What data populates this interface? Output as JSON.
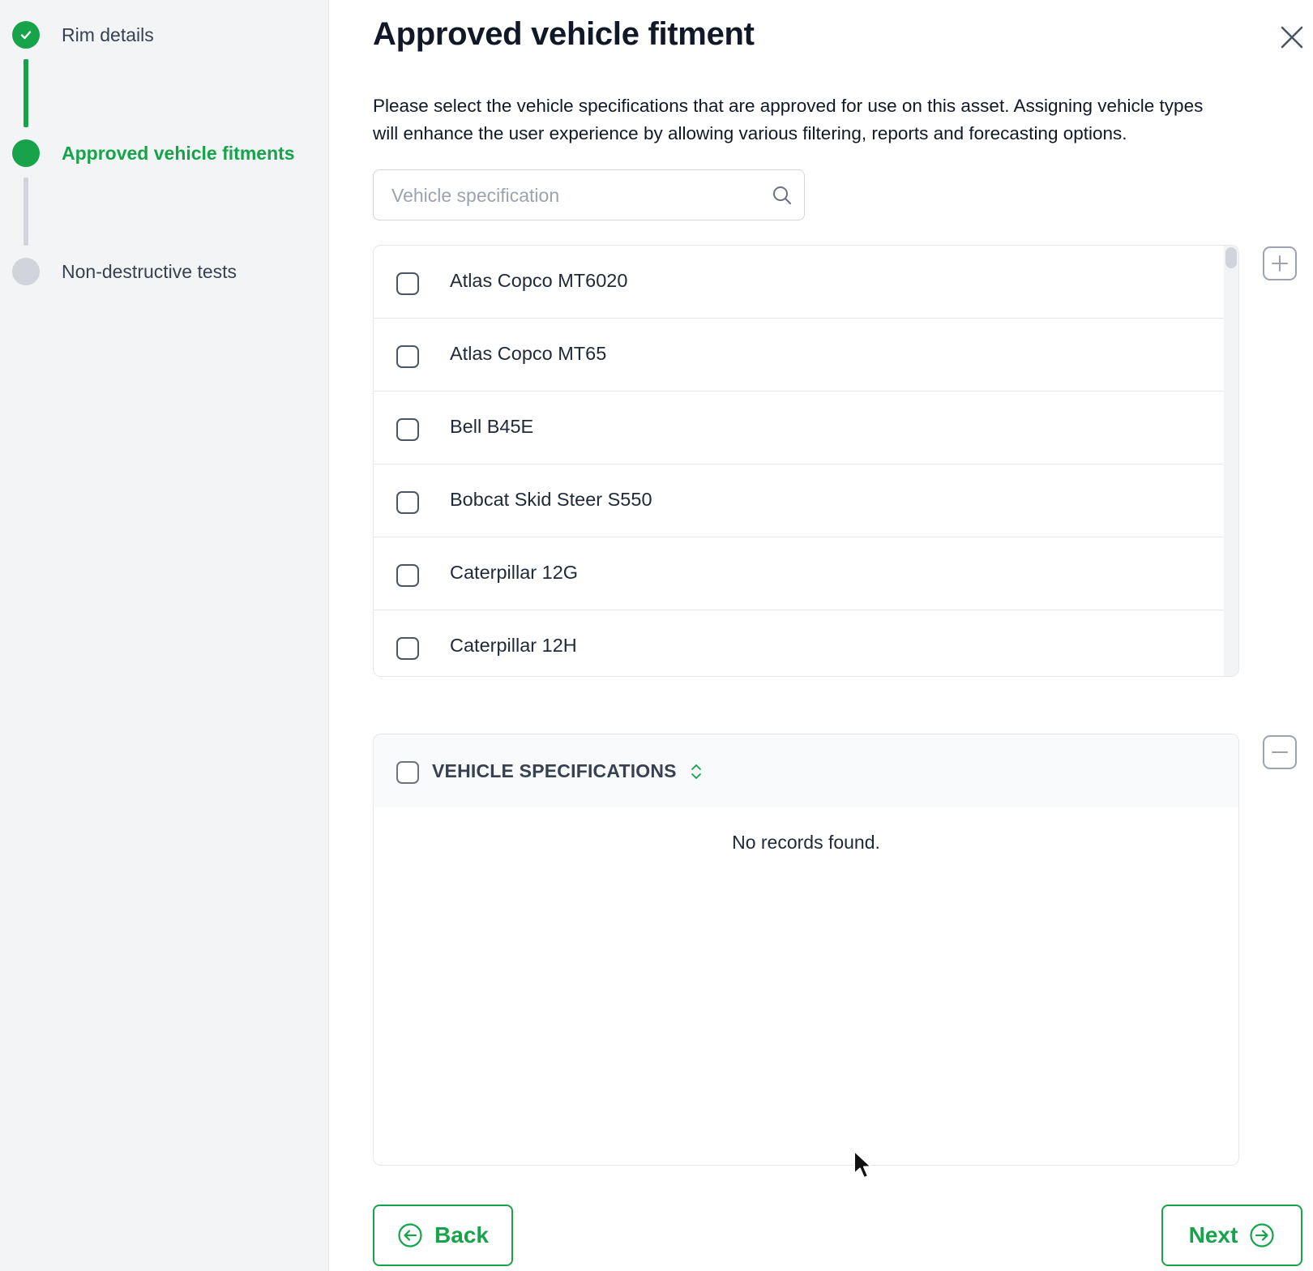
{
  "colors": {
    "accent": "#16a34a",
    "inactive": "#d1d5db",
    "text": "#1f2937",
    "sidebar_bg": "#f3f4f6"
  },
  "steps": [
    {
      "label": "Rim details",
      "status": "completed",
      "icon": "check-icon"
    },
    {
      "label": "Approved vehicle fitments",
      "status": "current",
      "icon": "dot"
    },
    {
      "label": "Non-destructive tests",
      "status": "upcoming",
      "icon": "dot"
    }
  ],
  "dialog": {
    "title": "Approved vehicle fitment",
    "description_line1": "Please select the vehicle specifications that are approved for use on this asset. Assigning vehicle types",
    "description_line2": "will enhance the user experience by allowing various filtering, reports and forecasting options.",
    "close_icon": "close-icon"
  },
  "search": {
    "placeholder": "Vehicle specification",
    "value": "",
    "icon": "search-icon"
  },
  "available_list": {
    "items": [
      {
        "label": "Atlas Copco MT6020",
        "checked": false
      },
      {
        "label": "Atlas Copco MT65",
        "checked": false
      },
      {
        "label": "Bell B45E",
        "checked": false
      },
      {
        "label": "Bobcat Skid Steer S550",
        "checked": false
      },
      {
        "label": "Caterpillar 12G",
        "checked": false
      },
      {
        "label": "Caterpillar 12H",
        "checked": false
      }
    ],
    "add_icon": "plus-icon"
  },
  "selected_table": {
    "column_header": "VEHICLE SPECIFICATIONS",
    "sort_icon": "sort-icon",
    "empty_message": "No records found.",
    "remove_icon": "minus-icon"
  },
  "footer": {
    "back_label": "Back",
    "back_icon": "arrow-left-circle-icon",
    "next_label": "Next",
    "next_icon": "arrow-right-circle-icon"
  }
}
